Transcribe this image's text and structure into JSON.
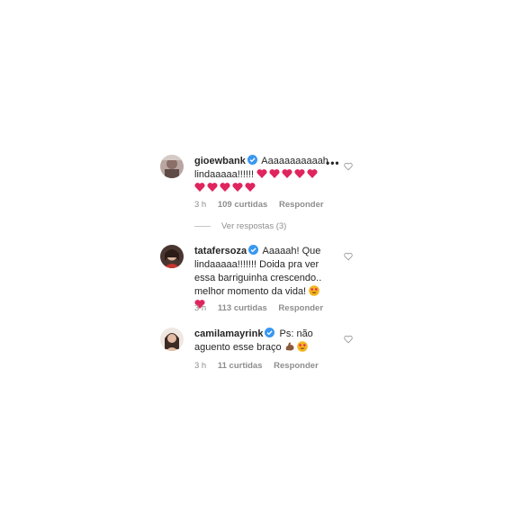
{
  "comments": [
    {
      "username": "gioewbank",
      "verified": true,
      "text": "Aaaaaaaaaaah lindaaaaa!!!!!!",
      "emoji_hearts": 10,
      "time": "3 h",
      "likes": "109 curtidas",
      "reply": "Responder",
      "view_replies": "Ver respostas (3)"
    },
    {
      "username": "tatafersoza",
      "verified": true,
      "text": "Aaaaah! Que lindaaaaa!!!!!!! Doida pra ver essa barriguinha crescendo.. melhor momento da vida!",
      "time": "3 h",
      "likes": "113 curtidas",
      "reply": "Responder"
    },
    {
      "username": "camilamayrink",
      "verified": true,
      "text": "Ps: não aguento esse braço",
      "time": "3 h",
      "likes": "11 curtidas",
      "reply": "Responder"
    }
  ],
  "colors": {
    "heart": "#e0245e",
    "verified": "#3897f0",
    "muted": "#8e8e8e"
  }
}
